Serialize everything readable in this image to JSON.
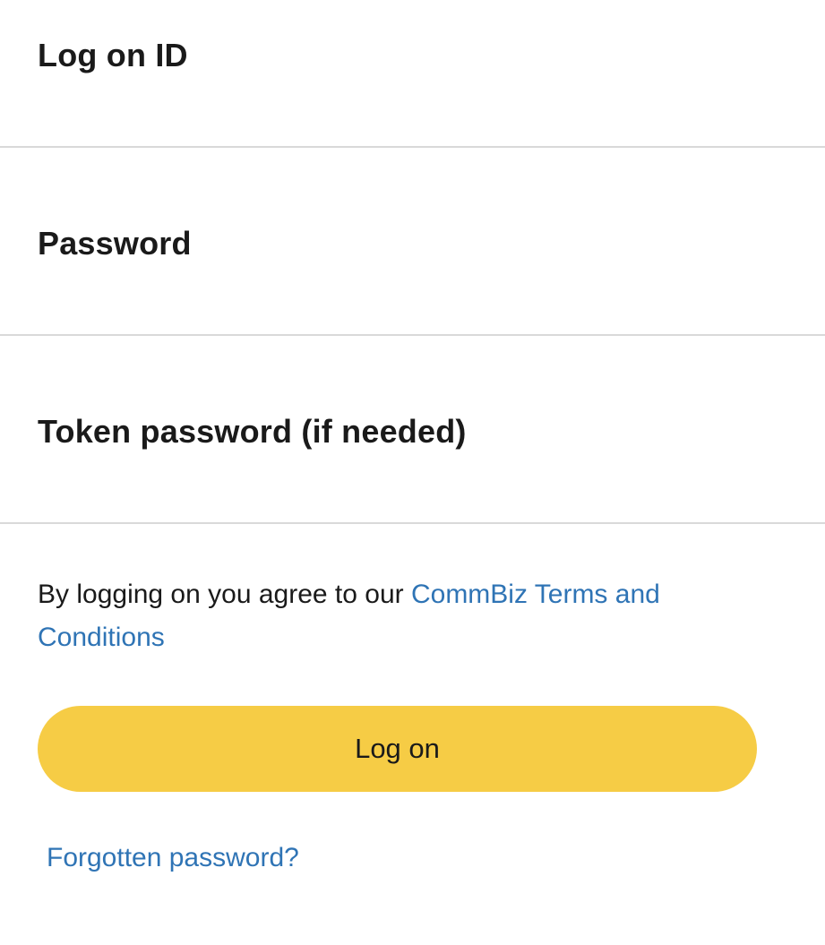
{
  "form": {
    "logon_id": {
      "label": "Log on ID",
      "value": ""
    },
    "password": {
      "label": "Password",
      "value": ""
    },
    "token_password": {
      "label": "Token password (if needed)",
      "value": ""
    }
  },
  "terms": {
    "prefix": "By logging on you agree to our",
    "link_text": "CommBiz Terms and Conditions"
  },
  "logon_button": {
    "label": "Log on"
  },
  "forgot_password": {
    "label": "Forgotten password?"
  },
  "colors": {
    "button_background": "#f6cc45",
    "link": "#2f74b5",
    "text": "#1a1a1a",
    "divider": "#d9d9d9"
  }
}
